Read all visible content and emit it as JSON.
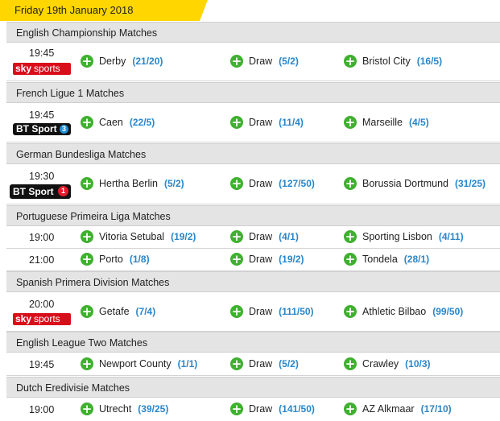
{
  "date": "Friday 19th January 2018",
  "colors": {
    "date_tab": "#ffd600",
    "plus": "#3fb02f",
    "odds": "#2a86c8",
    "sky": "#d80f1a",
    "bt": "#111111",
    "bt3": "#1e8fd8",
    "bt1": "#e8192c"
  },
  "sections": [
    {
      "title": "English Championship Matches",
      "matches": [
        {
          "time": "19:45",
          "tv": "Sky Sports",
          "home": "Derby",
          "home_odds": "(21/20)",
          "draw": "Draw",
          "draw_odds": "(5/2)",
          "away": "Bristol City",
          "away_odds": "(16/5)"
        }
      ]
    },
    {
      "title": "French Ligue 1 Matches",
      "matches": [
        {
          "time": "19:45",
          "tv": "BT Sport 3",
          "home": "Caen",
          "home_odds": "(22/5)",
          "draw": "Draw",
          "draw_odds": "(11/4)",
          "away": "Marseille",
          "away_odds": "(4/5)"
        }
      ]
    },
    {
      "title": "German Bundesliga Matches",
      "matches": [
        {
          "time": "19:30",
          "tv": "BT Sport 1",
          "home": "Hertha Berlin",
          "home_odds": "(5/2)",
          "draw": "Draw",
          "draw_odds": "(127/50)",
          "away": "Borussia Dortmund",
          "away_odds": "(31/25)"
        }
      ]
    },
    {
      "title": "Portuguese Primeira Liga Matches",
      "matches": [
        {
          "time": "19:00",
          "home": "Vitoria Setubal",
          "home_odds": "(19/2)",
          "draw": "Draw",
          "draw_odds": "(4/1)",
          "away": "Sporting Lisbon",
          "away_odds": "(4/11)"
        },
        {
          "time": "21:00",
          "home": "Porto",
          "home_odds": "(1/8)",
          "draw": "Draw",
          "draw_odds": "(19/2)",
          "away": "Tondela",
          "away_odds": "(28/1)"
        }
      ]
    },
    {
      "title": "Spanish Primera Division Matches",
      "matches": [
        {
          "time": "20:00",
          "tv": "Sky Sports",
          "home": "Getafe",
          "home_odds": "(7/4)",
          "draw": "Draw",
          "draw_odds": "(111/50)",
          "away": "Athletic Bilbao",
          "away_odds": "(99/50)"
        }
      ]
    },
    {
      "title": "English League Two Matches",
      "matches": [
        {
          "time": "19:45",
          "home": "Newport County",
          "home_odds": "(1/1)",
          "draw": "Draw",
          "draw_odds": "(5/2)",
          "away": "Crawley",
          "away_odds": "(10/3)"
        }
      ]
    },
    {
      "title": "Dutch Eredivisie Matches",
      "matches": [
        {
          "time": "19:00",
          "home": "Utrecht",
          "home_odds": "(39/25)",
          "draw": "Draw",
          "draw_odds": "(141/50)",
          "away": "AZ Alkmaar",
          "away_odds": "(17/10)"
        }
      ]
    }
  ],
  "tv_logos": {
    "sky_a": "sky",
    "sky_b": "sports",
    "bt_a": "BT Sport",
    "bt3": "3",
    "bt1": "1"
  }
}
